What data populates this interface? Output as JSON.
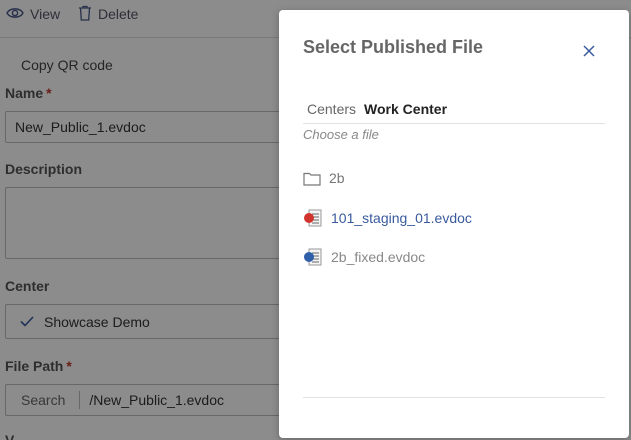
{
  "toolbar": {
    "view_label": "View",
    "delete_label": "Delete"
  },
  "form": {
    "copy_qr_label": "Copy QR code",
    "name_label": "Name",
    "required_mark": "*",
    "name_value": "New_Public_1.evdoc",
    "description_label": "Description",
    "description_value": "",
    "center_label": "Center",
    "center_value": "Showcase Demo",
    "file_path_label": "File Path",
    "search_button_label": "Search",
    "file_path_value": "/New_Public_1.evdoc",
    "truncated_label": "V..."
  },
  "modal": {
    "title": "Select Published File",
    "breadcrumb": {
      "root": "Centers",
      "current": "Work Center"
    },
    "hint": "Choose a file",
    "items": [
      {
        "type": "folder",
        "name": "2b"
      },
      {
        "type": "evdoc-file",
        "name": "101_staging_01.evdoc"
      },
      {
        "type": "evdoc-file",
        "name": "2b_fixed.evdoc"
      }
    ]
  },
  "colors": {
    "accent": "#3a5a9e",
    "overlay": "rgba(0,0,0,0.45)",
    "required": "#c0392b"
  },
  "icons": {
    "view": "eye-icon",
    "delete": "trash-icon",
    "close": "close-icon",
    "folder": "folder-icon",
    "file": "evdoc-file-icon",
    "check": "check-icon"
  }
}
